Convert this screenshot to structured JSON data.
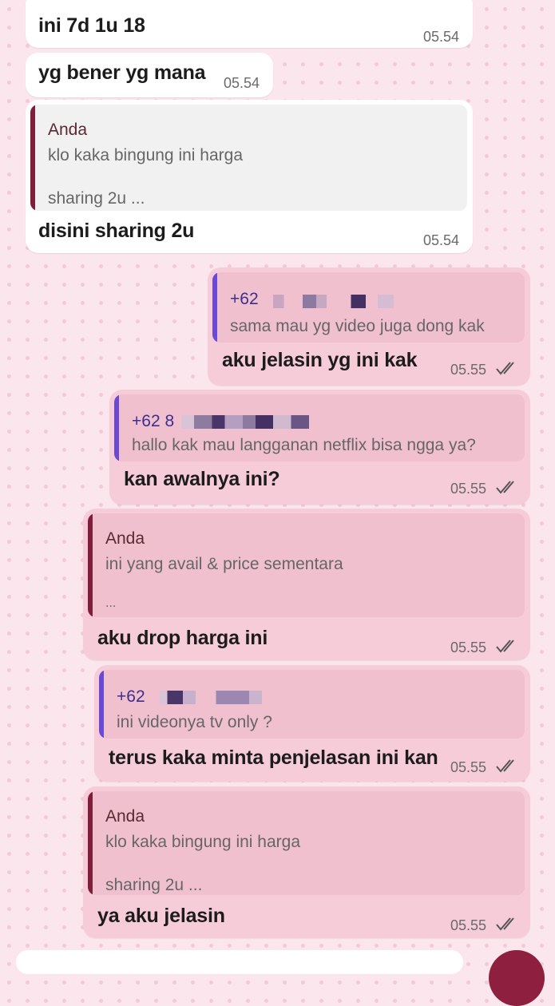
{
  "messages": [
    {
      "type": "incoming",
      "text": "ini 7d 1u 18",
      "time": "05.54"
    },
    {
      "type": "incoming",
      "text": "yg bener yg mana",
      "time": "05.54"
    },
    {
      "type": "incoming",
      "quote": {
        "name": "Anda",
        "lines": [
          "klo kaka bingung ini harga",
          "sharing 2u ..."
        ]
      },
      "text": "disini sharing 2u",
      "time": "05.54"
    },
    {
      "type": "outgoing",
      "quote": {
        "name": "+62",
        "lines": [
          "sama mau yg video juga dong kak"
        ]
      },
      "text": "aku jelasin yg ini kak",
      "time": "05.55",
      "status": "read"
    },
    {
      "type": "outgoing",
      "quote": {
        "name": "+62 8",
        "lines": [
          "hallo kak mau langganan netflix bisa ngga ya?"
        ]
      },
      "text": "kan awalnya ini?",
      "time": "05.55",
      "status": "read"
    },
    {
      "type": "outgoing",
      "quote": {
        "name": "Anda",
        "lines": [
          "ini yang avail & price sementara",
          "..."
        ]
      },
      "text": "aku drop harga ini",
      "time": "05.55",
      "status": "read"
    },
    {
      "type": "outgoing",
      "quote": {
        "name": "+62",
        "lines": [
          "ini videonya tv only ?"
        ]
      },
      "text": "terus kaka minta penjelasan ini kan",
      "time": "05.55",
      "status": "read"
    },
    {
      "type": "outgoing",
      "quote": {
        "name": "Anda",
        "lines": [
          "klo kaka bingung ini harga",
          "sharing 2u ..."
        ]
      },
      "text": "ya aku jelasin",
      "time": "05.55",
      "status": "read"
    }
  ],
  "colors": {
    "incoming_bubble": "#ffffff",
    "outgoing_bubble": "#f7ccd9",
    "quote_bar_self": "#7e1e3b",
    "quote_bar_contact": "#6a49d4",
    "tick": "#555555",
    "send_button": "#8e1f3e"
  },
  "icons": {
    "read_status": "double-check-icon",
    "send": "send-icon"
  }
}
